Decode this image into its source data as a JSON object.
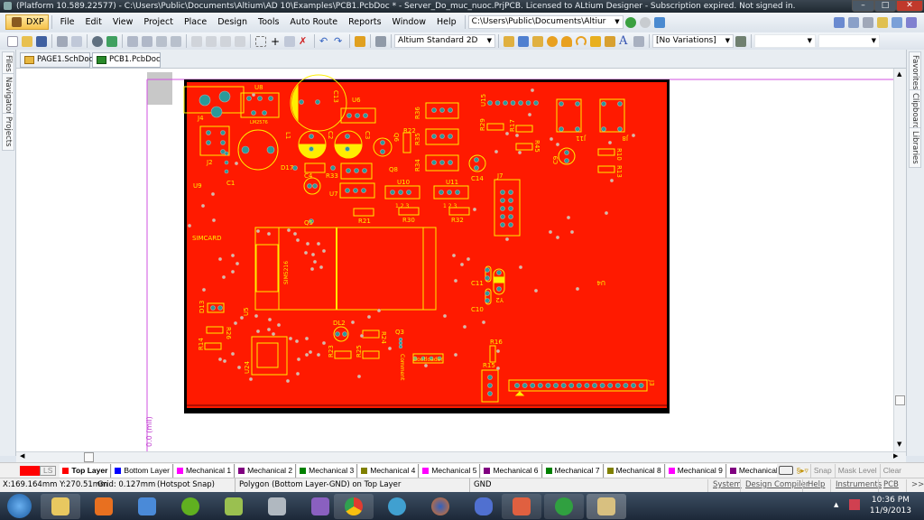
{
  "window": {
    "title": "(Platform 10.589.22577) - C:\\Users\\Public\\Documents\\Altium\\AD 10\\Examples\\PCB1.PcbDoc * - Server_Do_muc_nuoc.PrjPCB. Licensed to ALtium Designer - Subscription expired. Not signed in.",
    "minimize": "–",
    "maximize": "□",
    "close": "✕"
  },
  "menu": {
    "dxp": "DXP",
    "items": [
      "File",
      "Edit",
      "View",
      "Project",
      "Place",
      "Design",
      "Tools",
      "Auto Route",
      "Reports",
      "Window",
      "Help"
    ],
    "path": "C:\\Users\\Public\\Documents\\Altiur"
  },
  "toolbar": {
    "view_mode": "Altium Standard 2D",
    "variations": "[No Variations]",
    "combo3": "",
    "combo4": ""
  },
  "left_panels": [
    "Files",
    "Navigator",
    "Projects"
  ],
  "right_panels": [
    "Favorites",
    "Clipboard",
    "Libraries"
  ],
  "doc_tabs": [
    {
      "label": "PAGE1.SchDoc"
    },
    {
      "label": "PCB1.PcbDoc *",
      "active": true
    }
  ],
  "canvas": {
    "origin_label": "0.0 (mil)",
    "designators": {
      "J4": "J4",
      "U8": "U8",
      "LM2576": "LM2576",
      "C13": "C13",
      "U6": "U6",
      "L1": "L1",
      "C2": "C2",
      "C3": "C3",
      "Q6": "Q6",
      "R22": "R22",
      "D17": "D17",
      "C4": "C4",
      "R33": "R33",
      "J2": "J2",
      "U9": "U9",
      "C1": "C1",
      "U7": "U7",
      "U10": "U10",
      "U11": "U11",
      "R30": "R30",
      "R32": "R32",
      "R21": "R21",
      "Q5": "Q5",
      "Q8": "Q8",
      "R36": "R36",
      "R35": "R35",
      "R34": "R34",
      "U15": "U15",
      "R29": "R29",
      "R17": "R17",
      "R45": "R45",
      "C9": "C9",
      "C14": "C14",
      "J7": "J7",
      "J11": "J11",
      "J8": "J8",
      "R10": "R10",
      "R13": "R13",
      "SIMCARD": "SIMCARD",
      "SIM5216": "SIM5216",
      "D13": "D13",
      "U5": "U5",
      "DL2": "DL2",
      "Q3": "Q3",
      "R14": "R14",
      "R26": "R26",
      "U24": "U24",
      "R23": "R23",
      "R25": "R25",
      "R24": "R24",
      "C11": "C11",
      "C10": "C10",
      "Y2": "Y2",
      "U4": "U4",
      "R16": "R16",
      "R15": "R15",
      "J3": "J3",
      "BOOTLOADER": "Bootloader",
      "COMMENT": "Comment"
    },
    "pin_labels": {
      "u10": "1 2 3",
      "u11": "1 2 3"
    }
  },
  "layers": {
    "current_label": "LS",
    "tabs": [
      {
        "name": "Top Layer",
        "color": "#ff0000",
        "active": true
      },
      {
        "name": "Bottom Layer",
        "color": "#0000ff"
      },
      {
        "name": "Mechanical 1",
        "color": "#ff00ff"
      },
      {
        "name": "Mechanical 2",
        "color": "#800080"
      },
      {
        "name": "Mechanical 3",
        "color": "#008000"
      },
      {
        "name": "Mechanical 4",
        "color": "#808000"
      },
      {
        "name": "Mechanical 5",
        "color": "#ff00ff"
      },
      {
        "name": "Mechanical 6",
        "color": "#800080"
      },
      {
        "name": "Mechanical 7",
        "color": "#008000"
      },
      {
        "name": "Mechanical 8",
        "color": "#808000"
      },
      {
        "name": "Mechanical 9",
        "color": "#ff00ff"
      },
      {
        "name": "Mechanical",
        "color": "#800080"
      }
    ],
    "snap": "Snap",
    "mask_level": "Mask Level",
    "clear": "Clear"
  },
  "status": {
    "coords": "X:169.164mm Y:270.51mm",
    "grid": "Grid: 0.127mm",
    "snap": "(Hotspot Snap)",
    "object": "Polygon  (Bottom Layer-GND)  on Top Layer",
    "net": "GND",
    "buttons": [
      "System",
      "Design Compiler",
      "Help",
      "Instruments",
      "PCB"
    ],
    "more": ">>"
  },
  "taskbar": {
    "time": "10:36 PM",
    "date": "11/9/2013"
  },
  "colors": {
    "board": "#ff1a00",
    "silk": "#ffff00",
    "pad": "#2a9a9a",
    "guide": "#d050e0"
  }
}
